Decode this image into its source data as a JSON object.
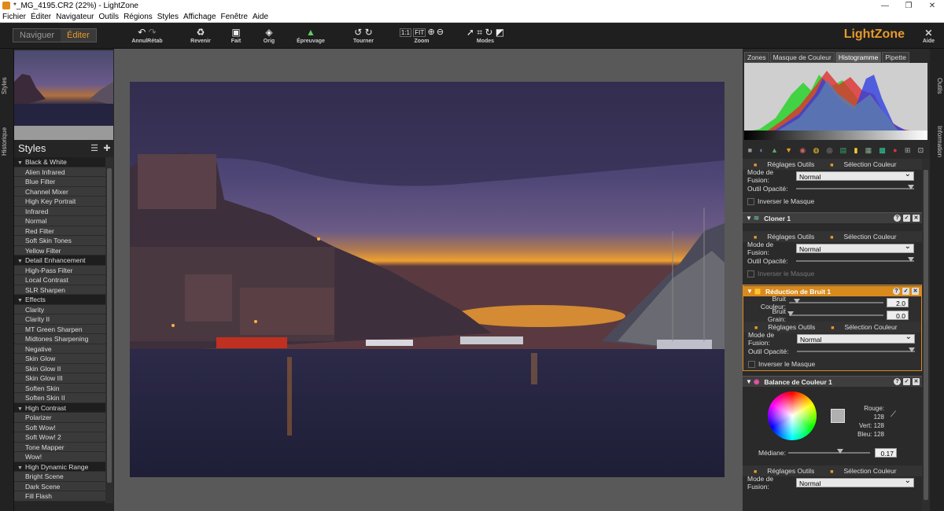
{
  "window": {
    "title": "*_MG_4195.CR2 (22%) - LightZone",
    "min": "—",
    "max": "❐",
    "close": "✕"
  },
  "menu": [
    "Fichier",
    "Éditer",
    "Navigateur",
    "Outils",
    "Régions",
    "Styles",
    "Affichage",
    "Fenêtre",
    "Aide"
  ],
  "mode": {
    "browse": "Naviguer",
    "edit": "Éditer"
  },
  "toolbar": {
    "undo": "AnnulRétab",
    "revert": "Revenir",
    "done": "Fait",
    "orig": "Orig",
    "proof": "Épreuvage",
    "rotate": "Tourner",
    "zoom": "Zoom",
    "zoom_1to1": "1:1",
    "zoom_fit": "FIT",
    "modes": "Modes",
    "help": "Aide",
    "logo": "LightZone"
  },
  "sidetabs": {
    "left": [
      "Styles",
      "Historique"
    ],
    "right": [
      "Outils",
      "Information"
    ]
  },
  "styles": {
    "title": "Styles",
    "list": [
      {
        "g": "Black & White"
      },
      {
        "i": "Alien Infrared"
      },
      {
        "i": "Blue Filter"
      },
      {
        "i": "Channel Mixer"
      },
      {
        "i": "High Key Portrait"
      },
      {
        "i": "Infrared"
      },
      {
        "i": "Normal"
      },
      {
        "i": "Red Filter"
      },
      {
        "i": "Soft Skin Tones"
      },
      {
        "i": "Yellow Filter"
      },
      {
        "g": "Detail Enhancement"
      },
      {
        "i": "High-Pass Filter"
      },
      {
        "i": "Local Contrast"
      },
      {
        "i": "SLR Sharpen"
      },
      {
        "g": "Effects"
      },
      {
        "i": "Clarity"
      },
      {
        "i": "Clarity II"
      },
      {
        "i": "MT Green Sharpen"
      },
      {
        "i": "Midtones Sharpening"
      },
      {
        "i": "Negative"
      },
      {
        "i": "Skin Glow"
      },
      {
        "i": "Skin Glow II"
      },
      {
        "i": "Skin Glow III"
      },
      {
        "i": "Soften Skin"
      },
      {
        "i": "Soften Skin II"
      },
      {
        "g": "High Contrast"
      },
      {
        "i": "Polarizer"
      },
      {
        "i": "Soft Wow!"
      },
      {
        "i": "Soft Wow! 2"
      },
      {
        "i": "Tone Mapper"
      },
      {
        "i": "Wow!"
      },
      {
        "g": "High Dynamic Range"
      },
      {
        "i": "Bright Scene"
      },
      {
        "i": "Dark Scene"
      },
      {
        "i": "Fill Flash"
      }
    ]
  },
  "righttabs": [
    "Zones",
    "Masque de Couleur",
    "Histogramme",
    "Pipette"
  ],
  "subtabs": {
    "a": "Réglages Outils",
    "b": "Sélection Couleur"
  },
  "labels": {
    "blend": "Mode de Fusion:",
    "opacity": "Outil Opacité:",
    "invert": "Inverser le Masque",
    "normal": "Normal",
    "noise_color": "Bruit Couleur:",
    "noise_grain": "Bruit Grain:",
    "median": "Médiane:",
    "red": "Rouge:",
    "green": "Vert:",
    "blue": "Bleu:"
  },
  "tools": {
    "cloner": "Cloner 1",
    "noise": "Réduction de Bruit 1",
    "balance": "Balance de Couleur 1"
  },
  "values": {
    "noise_color": "2.0",
    "noise_grain": "0.0",
    "median": "0.17",
    "red": "128",
    "green": "128",
    "blue": "128"
  },
  "colors": {
    "accent": "#e89a2a",
    "selection": "#d98a1c"
  }
}
